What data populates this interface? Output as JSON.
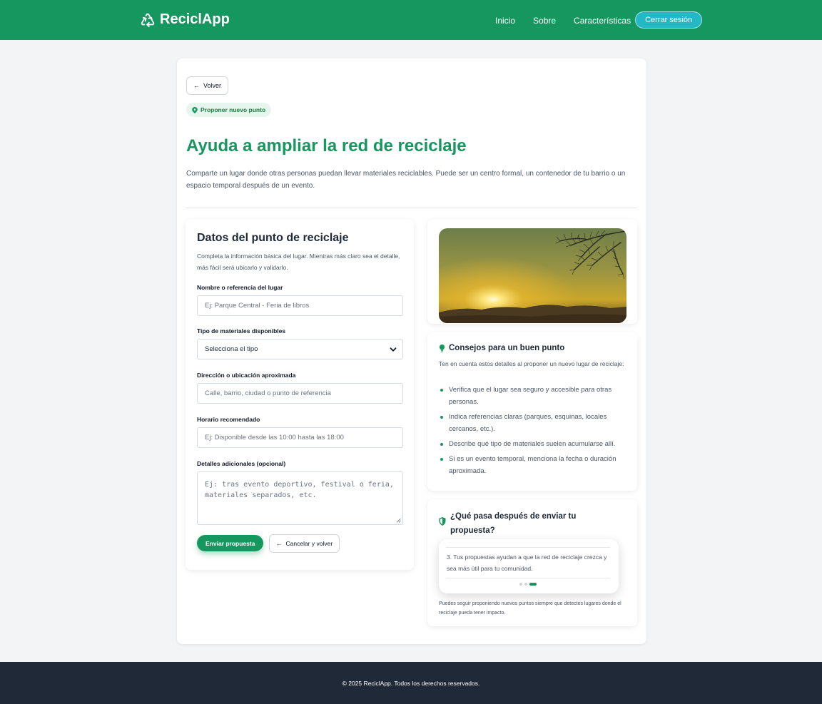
{
  "brand": {
    "name": "ReciclApp",
    "icon": "recycle-icon"
  },
  "nav": {
    "links": [
      "Inicio",
      "Sobre",
      "Características"
    ],
    "logout_label": "Cerrar sesión"
  },
  "colors": {
    "primary": "#16975f",
    "accent": "#22b8c6",
    "footer": "#1f2937"
  },
  "header": {
    "back_label": "Volver",
    "badge_label": "Proponer nuevo punto",
    "title": "Ayuda a ampliar la red de reciclaje",
    "description": "Comparte un lugar donde otras personas puedan llevar materiales reciclables. Puede ser un centro formal, un contenedor de tu barrio o un espacio temporal después de un evento."
  },
  "form": {
    "title": "Datos del punto de reciclaje",
    "intro": "Completa la información básica del lugar. Mientras más claro sea el detalle, más fácil será ubicarlo y validarlo.",
    "fields": {
      "name": {
        "label": "Nombre o referencia del lugar",
        "placeholder": "Ej: Parque Central - Feria de libros"
      },
      "type": {
        "label": "Tipo de materiales disponibles",
        "value": "Selecciona el tipo"
      },
      "address": {
        "label": "Dirección o ubicación aproximada",
        "placeholder": "Calle, barrio, ciudad o punto de referencia"
      },
      "schedule": {
        "label": "Horario recomendado",
        "placeholder": "Ej: Disponible desde las 10:00 hasta las 18:00"
      },
      "details": {
        "label": "Detalles adicionales (opcional)",
        "placeholder": "Ej: tras evento deportivo, festival o feria, materiales separados, etc."
      }
    },
    "submit_label": "Enviar propuesta",
    "cancel_label": "Cancelar y volver"
  },
  "tips": {
    "title": "Consejos para un buen punto",
    "intro": "Ten en cuenta estos detalles al proponer un nuevo lugar de reciclaje:",
    "items": [
      "Verifica que el lugar sea seguro y accesible para otras personas.",
      "Indica referencias claras (parques, esquinas, locales cercanos, etc.).",
      "Describe qué tipo de materiales suelen acumularse allí.",
      "Si es un evento temporal, menciona la fecha o duración aproximada."
    ]
  },
  "next": {
    "title": "¿Qué pasa después de enviar tu propuesta?",
    "slide_text": "3. Tus propuestas ayudan a que la red de reciclaje crezca y sea más útil para tu comunidad.",
    "slide_count": 3,
    "active_slide": 3,
    "note": "Puedes seguir proponiendo nuevos puntos siempre que detectes lugares donde el reciclaje pueda tener impacto."
  },
  "footer": {
    "text": "© 2025 ReciclApp. Todos los derechos reservados."
  }
}
